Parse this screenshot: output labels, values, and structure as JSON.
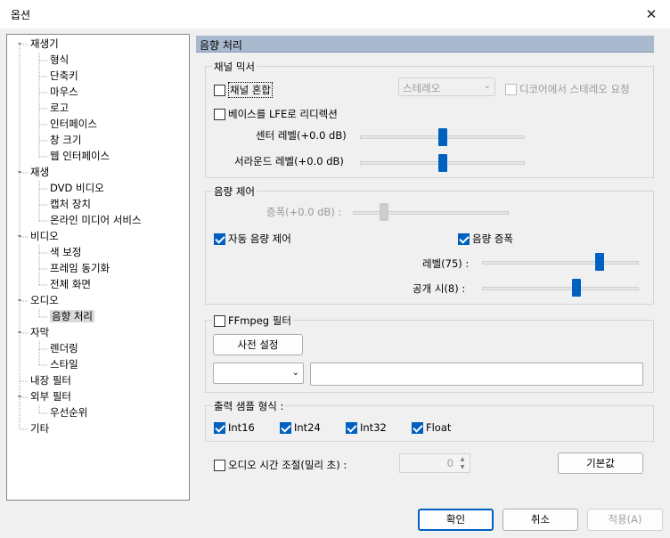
{
  "window": {
    "title": "옵션",
    "close_glyph": "✕"
  },
  "tree": {
    "nodes": [
      {
        "label": "재생기",
        "level": 0,
        "expanded": true
      },
      {
        "label": "형식",
        "level": 1
      },
      {
        "label": "단축키",
        "level": 1
      },
      {
        "label": "마우스",
        "level": 1
      },
      {
        "label": "로고",
        "level": 1
      },
      {
        "label": "인터페이스",
        "level": 1
      },
      {
        "label": "창 크기",
        "level": 1
      },
      {
        "label": "웹 인터페이스",
        "level": 1
      },
      {
        "label": "재생",
        "level": 0,
        "expanded": true
      },
      {
        "label": "DVD 비디오",
        "level": 1
      },
      {
        "label": "캡처 장치",
        "level": 1
      },
      {
        "label": "온라인 미디어 서비스",
        "level": 1
      },
      {
        "label": "비디오",
        "level": 0,
        "expanded": true
      },
      {
        "label": "색 보정",
        "level": 1
      },
      {
        "label": "프레임 동기화",
        "level": 1
      },
      {
        "label": "전체 화면",
        "level": 1
      },
      {
        "label": "오디오",
        "level": 0,
        "expanded": true
      },
      {
        "label": "음향 처리",
        "level": 1,
        "selected": true
      },
      {
        "label": "자막",
        "level": 0,
        "expanded": true
      },
      {
        "label": "렌더링",
        "level": 1
      },
      {
        "label": "스타일",
        "level": 1
      },
      {
        "label": "내장 필터",
        "level": 0
      },
      {
        "label": "외부 필터",
        "level": 0,
        "expanded": true
      },
      {
        "label": "우선순위",
        "level": 1
      },
      {
        "label": "기타",
        "level": 0
      }
    ]
  },
  "panel": {
    "header": "음향 처리",
    "channel_mixer": {
      "title": "채널 믹서",
      "mix_label": "채널 혼합",
      "mix_checked": false,
      "mode_value": "스테레오",
      "decoder_stereo_label": "디코어에서 스테레오 요청",
      "lfe_label": "베이스를 LFE로 리디렉션",
      "center_label": "센터 레벨(+0.0 dB)",
      "center_level": 0.5,
      "surround_label": "서라운드 레벨(+0.0 dB)",
      "surround_level": 0.5
    },
    "volume": {
      "title": "음량 제어",
      "gain_label": "증폭(+0.0 dB) :",
      "gain_level": 0.2,
      "auto_label": "자동 음량 제어",
      "auto_checked": true,
      "boost_label": "음량 증폭",
      "boost_checked": true,
      "level_label": "레벨(75) :",
      "level_value": 0.75,
      "release_label": "공개 시(8) :",
      "release_value": 0.6
    },
    "ffmpeg": {
      "label": "FFmpeg 필터",
      "checked": false,
      "preset_button": "사전 설정",
      "dropdown_value": "",
      "filter_text": ""
    },
    "output": {
      "title": "출력 샘플 형식 :",
      "formats": [
        {
          "label": "Int16",
          "checked": true
        },
        {
          "label": "Int24",
          "checked": true
        },
        {
          "label": "Int32",
          "checked": true
        },
        {
          "label": "Float",
          "checked": true
        }
      ]
    },
    "time_shift": {
      "label": "오디오 시간 조절(밀리 초) :",
      "checked": false,
      "value": "0"
    },
    "default_button": "기본값"
  },
  "footer": {
    "ok": "확인",
    "cancel": "취소",
    "apply": "적용(A)"
  }
}
